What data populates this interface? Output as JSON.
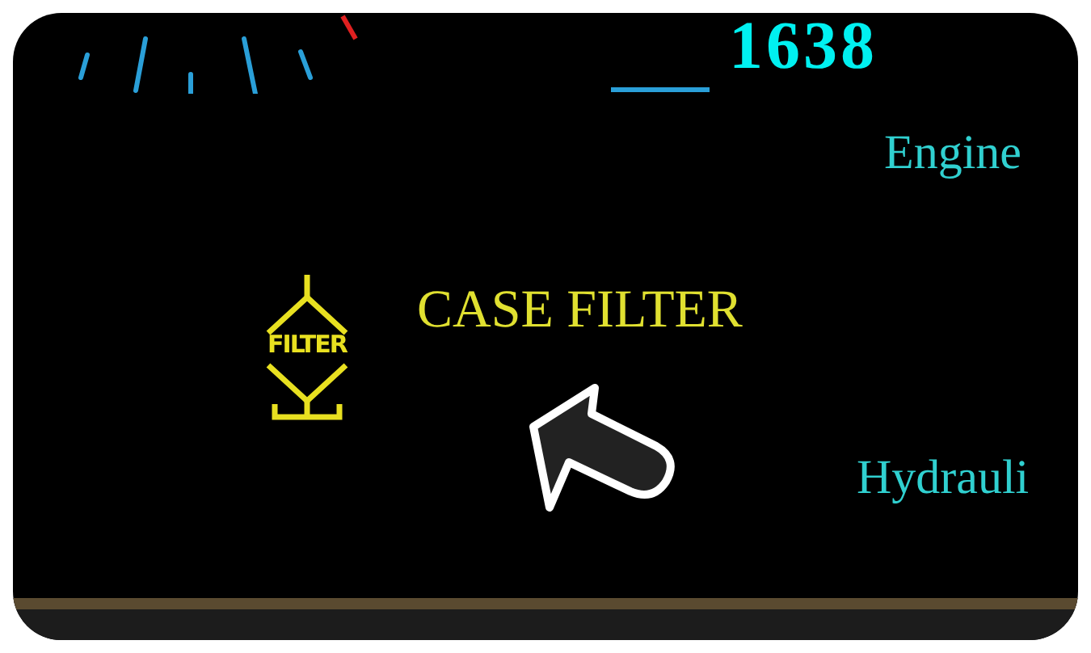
{
  "gauge": {
    "reading": "1638"
  },
  "engine_label": "Engine",
  "warning": {
    "icon_text": "FILTER",
    "label": "CASE FILTER"
  },
  "hydraulic_label": "Hydrauli"
}
